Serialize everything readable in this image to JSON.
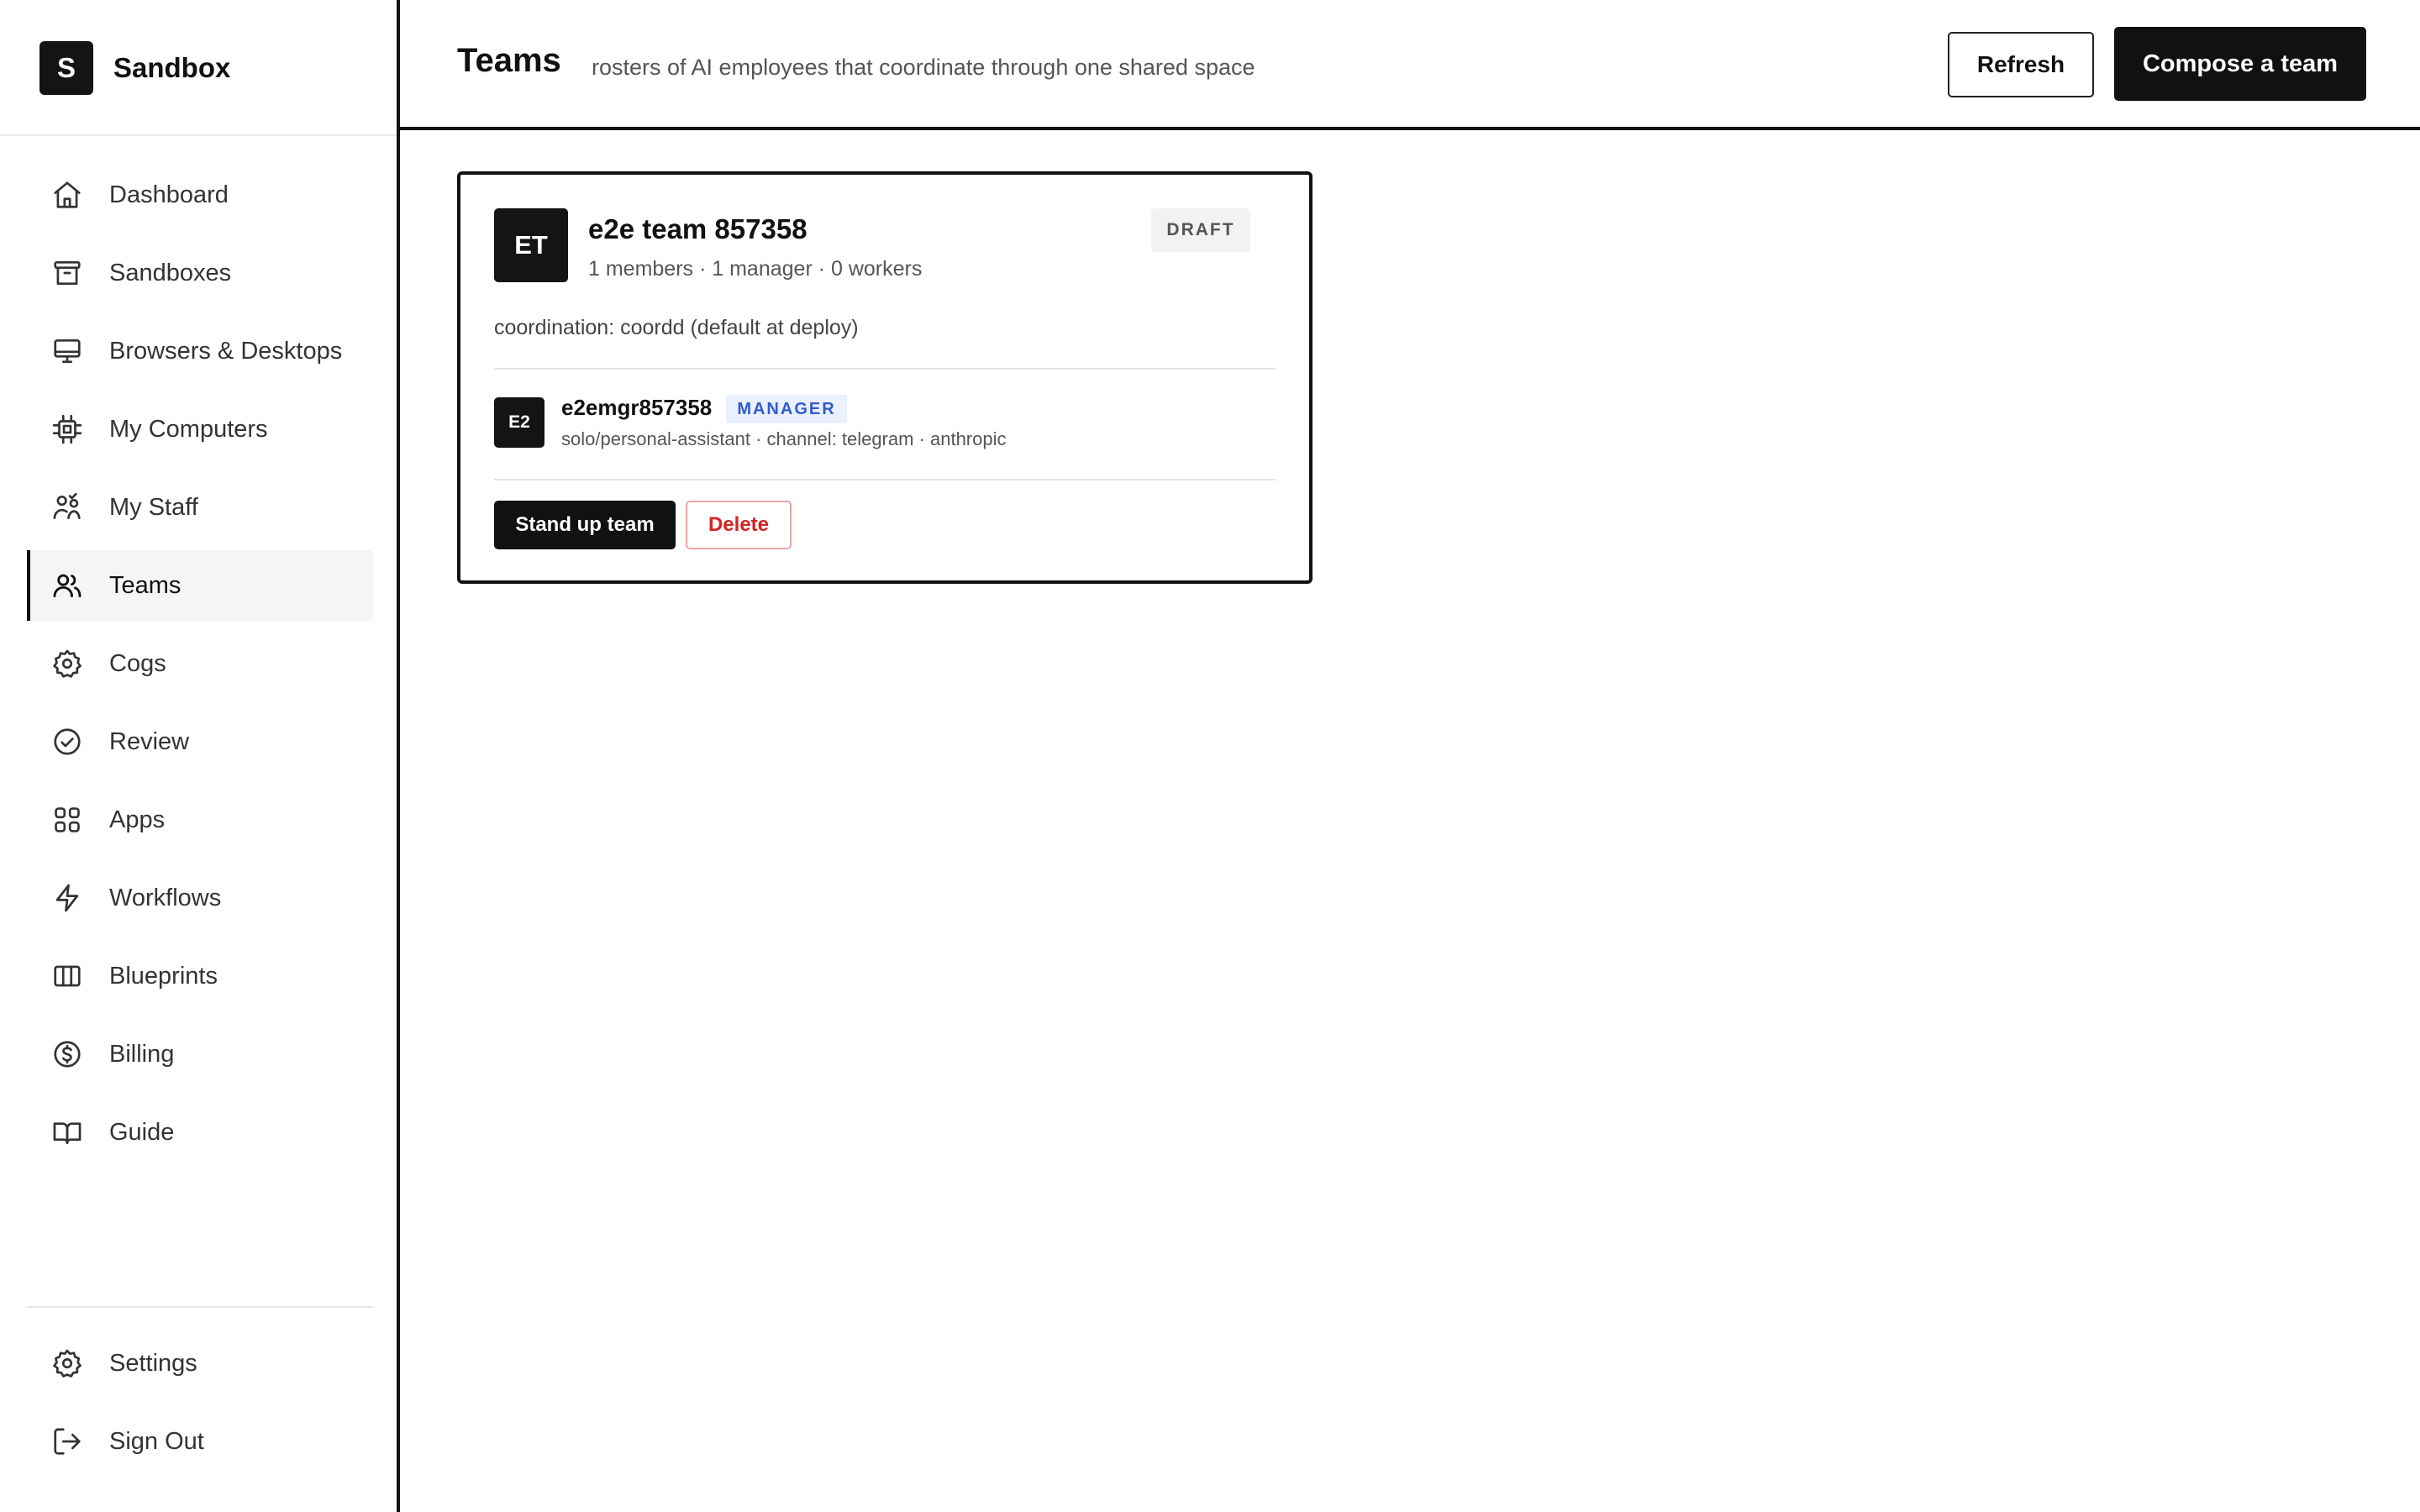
{
  "brand": {
    "logo_letter": "S",
    "name": "Sandbox"
  },
  "sidebar": {
    "items": [
      {
        "label": "Dashboard",
        "icon": "home-icon",
        "active": false
      },
      {
        "label": "Sandboxes",
        "icon": "archive-icon",
        "active": false
      },
      {
        "label": "Browsers & Desktops",
        "icon": "monitor-icon",
        "active": false
      },
      {
        "label": "My Computers",
        "icon": "cpu-icon",
        "active": false
      },
      {
        "label": "My Staff",
        "icon": "staff-icon",
        "active": false
      },
      {
        "label": "Teams",
        "icon": "users-icon",
        "active": true
      },
      {
        "label": "Cogs",
        "icon": "cog-icon",
        "active": false
      },
      {
        "label": "Review",
        "icon": "check-circle-icon",
        "active": false
      },
      {
        "label": "Apps",
        "icon": "apps-grid-icon",
        "active": false
      },
      {
        "label": "Workflows",
        "icon": "lightning-icon",
        "active": false
      },
      {
        "label": "Blueprints",
        "icon": "columns-icon",
        "active": false
      },
      {
        "label": "Billing",
        "icon": "dollar-circle-icon",
        "active": false
      },
      {
        "label": "Guide",
        "icon": "book-icon",
        "active": false
      }
    ],
    "bottom_items": [
      {
        "label": "Settings",
        "icon": "settings-gear-icon"
      },
      {
        "label": "Sign Out",
        "icon": "sign-out-icon"
      }
    ]
  },
  "header": {
    "title": "Teams",
    "subtitle": "rosters of AI employees that coordinate through one shared space",
    "refresh_label": "Refresh",
    "compose_label": "Compose a team"
  },
  "team_card": {
    "avatar_initials": "ET",
    "name": "e2e team 857358",
    "meta": "1 members · 1 manager · 0 workers",
    "status": "DRAFT",
    "coordination": "coordination: coordd (default at deploy)",
    "members": [
      {
        "avatar_initials": "E2",
        "name": "e2emgr857358",
        "role": "MANAGER",
        "details": "solo/personal-assistant · channel: telegram · anthropic"
      }
    ],
    "standup_label": "Stand up team",
    "delete_label": "Delete"
  },
  "colors": {
    "primary": "#111111",
    "active_nav_bg": "#f5f5f5",
    "manager_badge_bg": "#eaf0fd",
    "manager_badge_text": "#2f5bd0",
    "delete_text": "#d42323",
    "delete_border": "#f0a3a3"
  }
}
